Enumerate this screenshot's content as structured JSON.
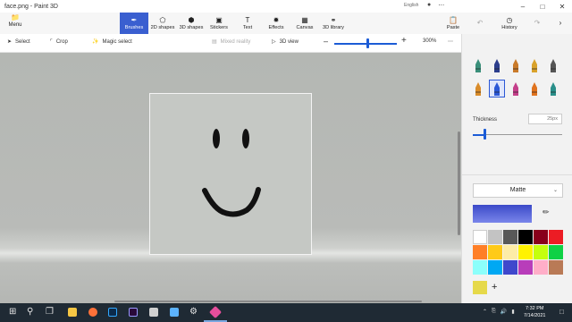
{
  "window": {
    "title": "face.png - Paint 3D",
    "account_name": "English",
    "account_icons": [
      "person-icon",
      "ellipsis-icon"
    ],
    "controls": [
      "minimize",
      "maximize",
      "close"
    ]
  },
  "ribbon": {
    "menu": {
      "label": "Menu",
      "icon": "folder-icon"
    },
    "tools": [
      {
        "label": "Brushes",
        "icon": "brush-icon",
        "active": true
      },
      {
        "label": "2D shapes",
        "icon": "shapes-2d-icon"
      },
      {
        "label": "3D shapes",
        "icon": "cube-icon"
      },
      {
        "label": "Stickers",
        "icon": "sticker-icon"
      },
      {
        "label": "Text",
        "icon": "text-icon"
      },
      {
        "label": "Effects",
        "icon": "effects-icon"
      },
      {
        "label": "Canvas",
        "icon": "canvas-icon"
      },
      {
        "label": "3D library",
        "icon": "library-icon"
      }
    ],
    "right_tools": [
      {
        "label": "Paste",
        "icon": "paste-icon",
        "disabled": false
      },
      {
        "label": "",
        "icon": "undo-icon",
        "disabled": true
      },
      {
        "label": "History",
        "icon": "history-icon",
        "disabled": false
      },
      {
        "label": "",
        "icon": "redo-icon",
        "disabled": true
      }
    ]
  },
  "toolbar2": {
    "select_label": "Select",
    "crop_label": "Crop",
    "magic_select_label": "Magic select",
    "mixed_reality_label": "Mixed reality",
    "view3d_label": "3D view",
    "zoom_level": "300%",
    "zoom_fraction": 0.53
  },
  "panel": {
    "brushes": [
      {
        "name": "marker",
        "color": "#3a8f7a"
      },
      {
        "name": "calligraphy-pen",
        "color": "#2c3e8c"
      },
      {
        "name": "oil-brush",
        "color": "#c97a2a"
      },
      {
        "name": "watercolor",
        "color": "#d9a22b"
      },
      {
        "name": "pixel-pen",
        "color": "#555555"
      },
      {
        "name": "pencil",
        "color": "#d98c2a"
      },
      {
        "name": "eraser",
        "color": "#2b58d6",
        "selected": true
      },
      {
        "name": "crayon",
        "color": "#c43f8a"
      },
      {
        "name": "spray-can",
        "color": "#e0731f"
      },
      {
        "name": "fill",
        "color": "#2a8f8a"
      }
    ],
    "thickness_label": "Thickness",
    "thickness_value": "25px",
    "thickness_fraction": 0.13,
    "finish": "Matte",
    "current_color": "#3b4ac8",
    "palette": [
      "#ffffff",
      "#c3c3c3",
      "#585858",
      "#000000",
      "#88001b",
      "#ec1c24",
      "#ff7f27",
      "#ffca18",
      "#fdeca6",
      "#fff200",
      "#c4ff0e",
      "#0ed145",
      "#8cfffb",
      "#00a8f3",
      "#3f48cc",
      "#b83dba",
      "#ffaec8",
      "#b97a56"
    ],
    "custom_color": "#e6d94a",
    "add_color_label": "+"
  },
  "taskbar": {
    "time": "7:32 PM",
    "date": "7/14/2021",
    "apps": [
      {
        "name": "start",
        "color": "#ffffff"
      },
      {
        "name": "search",
        "color": "#ffffff"
      },
      {
        "name": "task-view",
        "color": "#ffffff"
      },
      {
        "name": "file-explorer",
        "color": "#f6c744"
      },
      {
        "name": "firefox",
        "color": "#ff7139"
      },
      {
        "name": "photoshop",
        "color": "#31a8ff"
      },
      {
        "name": "premiere",
        "color": "#9999ff"
      },
      {
        "name": "calculator",
        "color": "#d0d0d0"
      },
      {
        "name": "media-app",
        "color": "#5cb3ff"
      },
      {
        "name": "settings",
        "color": "#ffffff"
      },
      {
        "name": "paint-3d",
        "color": "#e64e9b"
      }
    ]
  }
}
